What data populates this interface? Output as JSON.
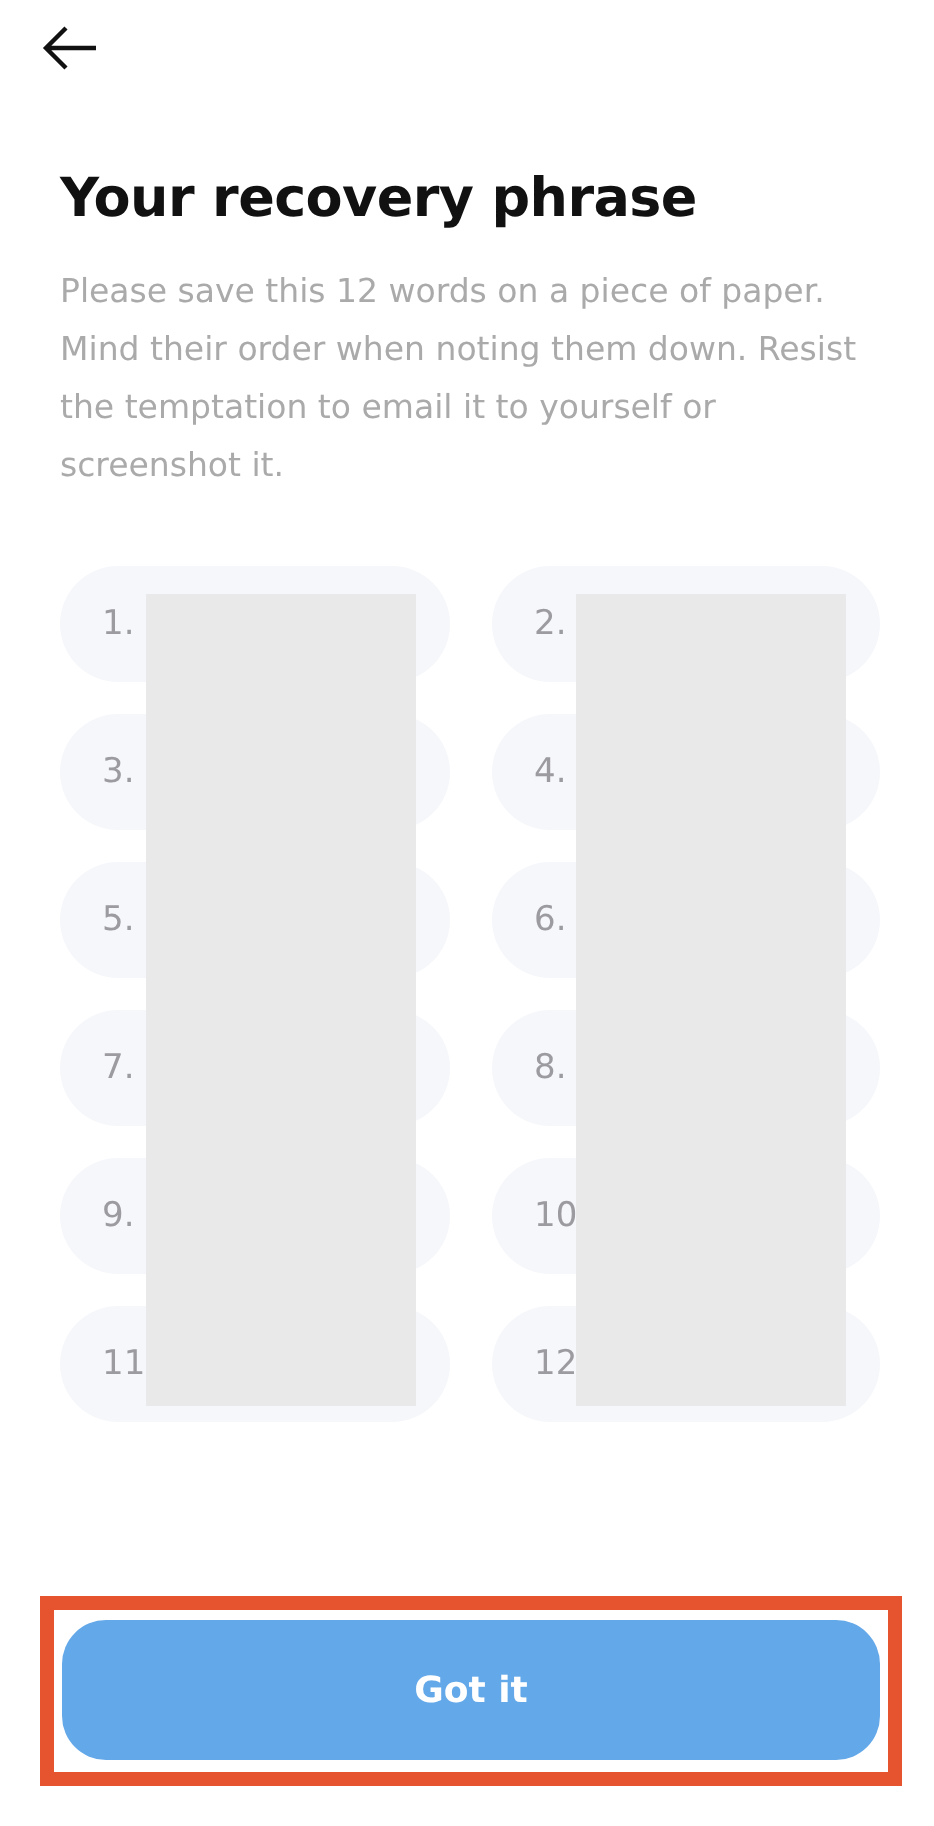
{
  "title": "Your recovery phrase",
  "description": "Please save this 12 words on a piece of paper. Mind their order when noting them down. Resist the temptation to email it to yourself or screenshot it.",
  "words": [
    {
      "label": "1."
    },
    {
      "label": "2."
    },
    {
      "label": "3."
    },
    {
      "label": "4."
    },
    {
      "label": "5."
    },
    {
      "label": "6."
    },
    {
      "label": "7."
    },
    {
      "label": "8."
    },
    {
      "label": "9."
    },
    {
      "label": "10"
    },
    {
      "label": "11"
    },
    {
      "label": "12"
    }
  ],
  "button": {
    "label": "Got it",
    "highlighted": true
  }
}
